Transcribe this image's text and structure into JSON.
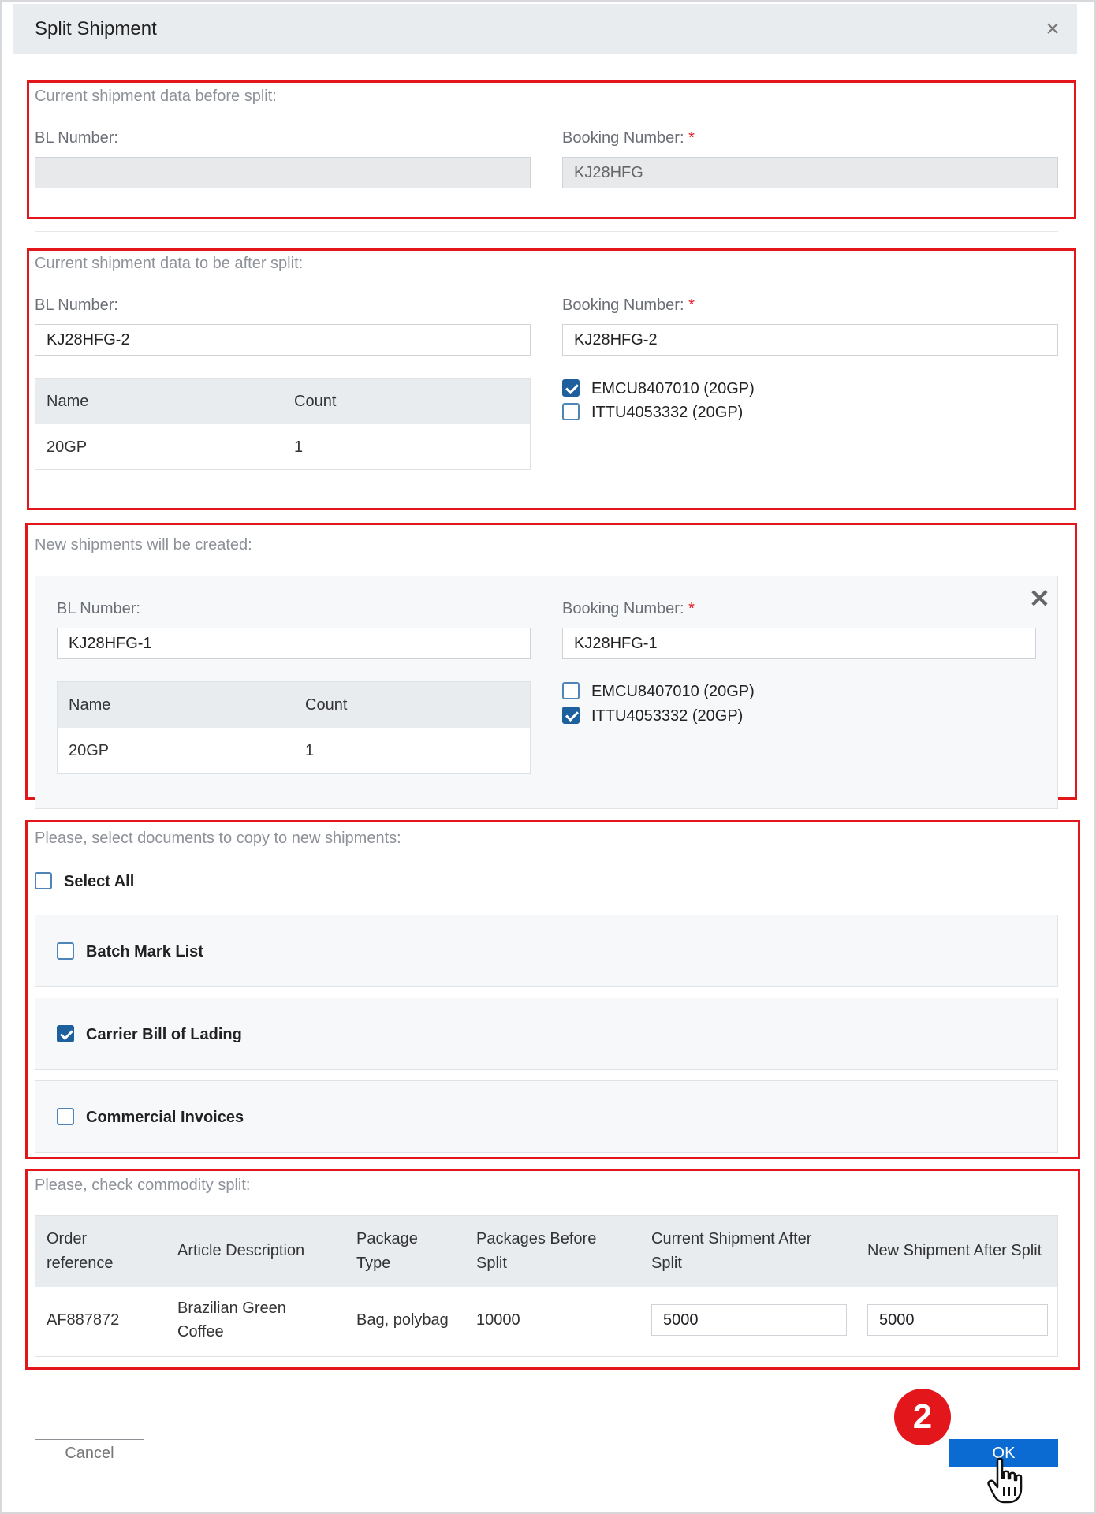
{
  "dialog": {
    "title": "Split Shipment"
  },
  "before_split": {
    "title": "Current shipment data before split:",
    "bl_label": "BL Number:",
    "bl_value": "",
    "booking_label": "Booking Number:",
    "required_mark": "*",
    "booking_value": "KJ28HFG"
  },
  "after_split": {
    "title": "Current shipment data to be after split:",
    "bl_label": "BL Number:",
    "bl_value": "KJ28HFG-2",
    "booking_label": "Booking Number:",
    "required_mark": "*",
    "booking_value": "KJ28HFG-2",
    "table": {
      "headers": [
        "Name",
        "Count"
      ],
      "rows": [
        [
          "20GP",
          "1"
        ]
      ]
    },
    "containers": [
      {
        "label": "EMCU8407010 (20GP)",
        "checked": true
      },
      {
        "label": "ITTU4053332 (20GP)",
        "checked": false
      }
    ]
  },
  "new_shipments": {
    "title": "New shipments will be created:",
    "bl_label": "BL Number:",
    "bl_value": "KJ28HFG-1",
    "booking_label": "Booking Number:",
    "required_mark": "*",
    "booking_value": "KJ28HFG-1",
    "table": {
      "headers": [
        "Name",
        "Count"
      ],
      "rows": [
        [
          "20GP",
          "1"
        ]
      ]
    },
    "containers": [
      {
        "label": "EMCU8407010 (20GP)",
        "checked": false
      },
      {
        "label": "ITTU4053332 (20GP)",
        "checked": true
      }
    ]
  },
  "documents": {
    "title": "Please, select documents to copy to new shipments:",
    "select_all": {
      "label": "Select All",
      "checked": false
    },
    "items": [
      {
        "label": "Batch Mark List",
        "checked": false
      },
      {
        "label": "Carrier Bill of Lading",
        "checked": true
      },
      {
        "label": "Commercial Invoices",
        "checked": false
      }
    ]
  },
  "commodity": {
    "title": "Please, check commodity split:",
    "headers": {
      "order_ref": [
        "Order",
        "reference"
      ],
      "article": "Article Description",
      "package_type": [
        "Package",
        "Type"
      ],
      "packages_before": [
        "Packages Before",
        "Split"
      ],
      "current_after": [
        "Current Shipment After",
        "Split"
      ],
      "new_after": "New Shipment After Split"
    },
    "row": {
      "order_ref": "AF887872",
      "article": [
        "Brazilian Green",
        "Coffee"
      ],
      "package_type": "Bag, polybag",
      "packages_before": "10000",
      "current_after": "5000",
      "new_after": "5000"
    }
  },
  "footer": {
    "cancel_label": "Cancel",
    "ok_label": "OK",
    "step_number": "2"
  },
  "colors": {
    "accent_red": "#e3161c",
    "primary_blue": "#0b6bd3",
    "checkbox_blue": "#1e5f9e"
  }
}
